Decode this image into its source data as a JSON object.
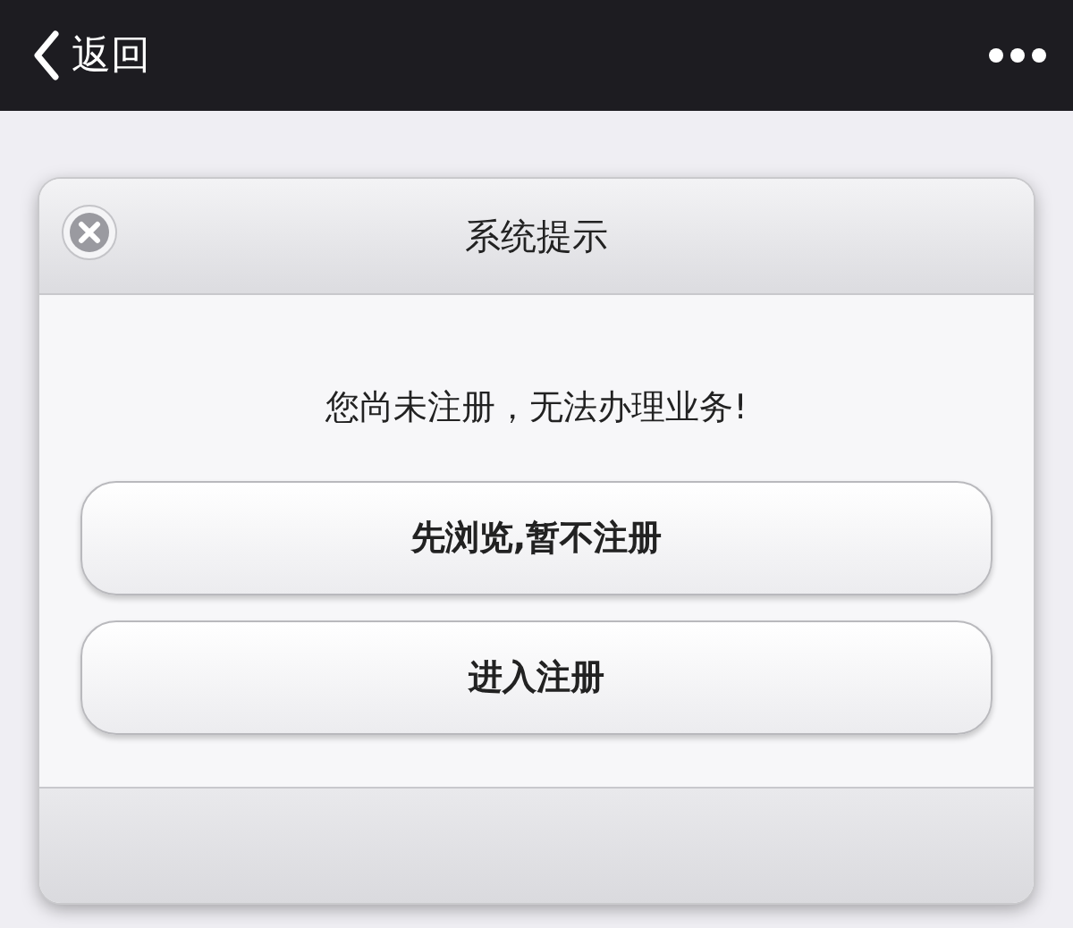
{
  "nav_bar": {
    "back_label": "返回"
  },
  "dialog": {
    "title": "系统提示",
    "message": "您尚未注册，无法办理业务!",
    "buttons": [
      {
        "label": "先浏览,暂不注册"
      },
      {
        "label": "进入注册"
      }
    ]
  }
}
